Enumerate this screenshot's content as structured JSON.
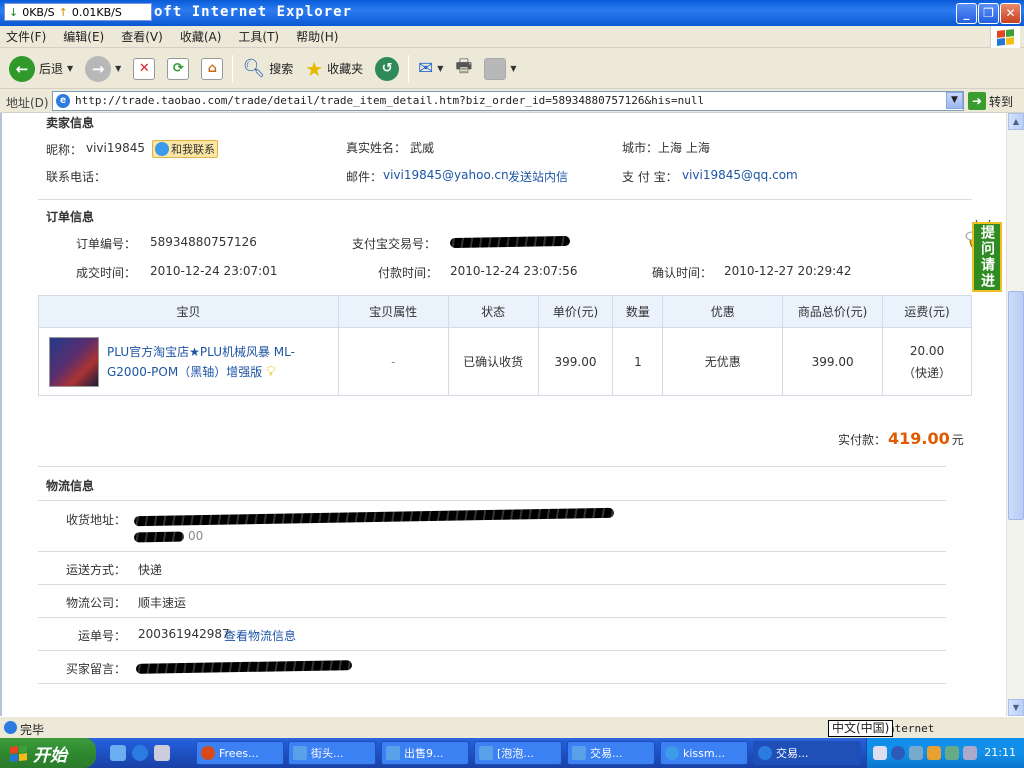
{
  "window": {
    "title": "oft Internet Explorer",
    "net_down": "0KB/S",
    "net_up": "0.01KB/S"
  },
  "menu": [
    "文件(F)",
    "编辑(E)",
    "查看(V)",
    "收藏(A)",
    "工具(T)",
    "帮助(H)"
  ],
  "toolbar": {
    "back": "后退",
    "search": "搜索",
    "favorites": "收藏夹"
  },
  "address": {
    "label": "地址(D)",
    "url": "http://trade.taobao.com/trade/detail/trade_item_detail.htm?biz_order_id=58934880757126&his=null",
    "go": "转到"
  },
  "seller": {
    "section": "卖家信息",
    "nick_label": "昵称：",
    "nick": "vivi19845",
    "contact": "和我联系",
    "realname_label": "真实姓名：",
    "realname": "武威",
    "city_label": "城市：",
    "city": "上海 上海",
    "phone_label": "联系电话：",
    "email_label": "邮件：",
    "email": "vivi19845@yahoo.cn",
    "msg_link": "发送站内信",
    "alipay_label": "支 付 宝：",
    "alipay": "vivi19845@qq.com"
  },
  "order": {
    "section": "订单信息",
    "no_label": "订单编号：",
    "no": "58934880757126",
    "alipay_no_label": "支付宝交易号：",
    "deal_time_label": "成交时间：",
    "deal_time": "2010-12-24 23:07:01",
    "pay_time_label": "付款时间：",
    "pay_time": "2010-12-24 23:07:56",
    "confirm_time_label": "确认时间：",
    "confirm_time": "2010-12-27 20:29:42"
  },
  "table": {
    "headers": [
      "宝贝",
      "宝贝属性",
      "状态",
      "单价(元)",
      "数量",
      "优惠",
      "商品总价(元)",
      "运费(元)"
    ],
    "item": {
      "name": "PLU官方淘宝店★PLU机械风暴 ML-G2000-POM（黑轴）增强版",
      "attr": "-",
      "status": "已确认收货",
      "price": "399.00",
      "qty": "1",
      "discount": "无优惠",
      "total": "399.00",
      "shipping": "20.00",
      "shipping_type": "（快递）"
    }
  },
  "payment": {
    "label": "实付款：",
    "amount": "419.00",
    "unit": "元"
  },
  "logistics": {
    "section": "物流信息",
    "address_label": "收货地址：",
    "address_tail": "00",
    "method_label": "运送方式：",
    "method": "快递",
    "company_label": "物流公司：",
    "company": "顺丰速运",
    "waybill_label": "运单号：",
    "waybill": "200361942987",
    "track_link": "查看物流信息",
    "buyer_msg_label": "买家留言："
  },
  "side": {
    "ask": "提问请进"
  },
  "status": {
    "text": "完毕",
    "zone": "nternet",
    "ime": "中文(中国)"
  },
  "taskbar": {
    "start": "开始",
    "tasks": [
      "Frees...",
      "街头...",
      "出售9...",
      "[泡泡...",
      "交易...",
      "kissm...",
      "交易..."
    ],
    "clock": "21:11"
  },
  "colors": {
    "accent_price": "#e05a00",
    "link": "#1d55a5",
    "titlebar": "#0a5bd8"
  }
}
